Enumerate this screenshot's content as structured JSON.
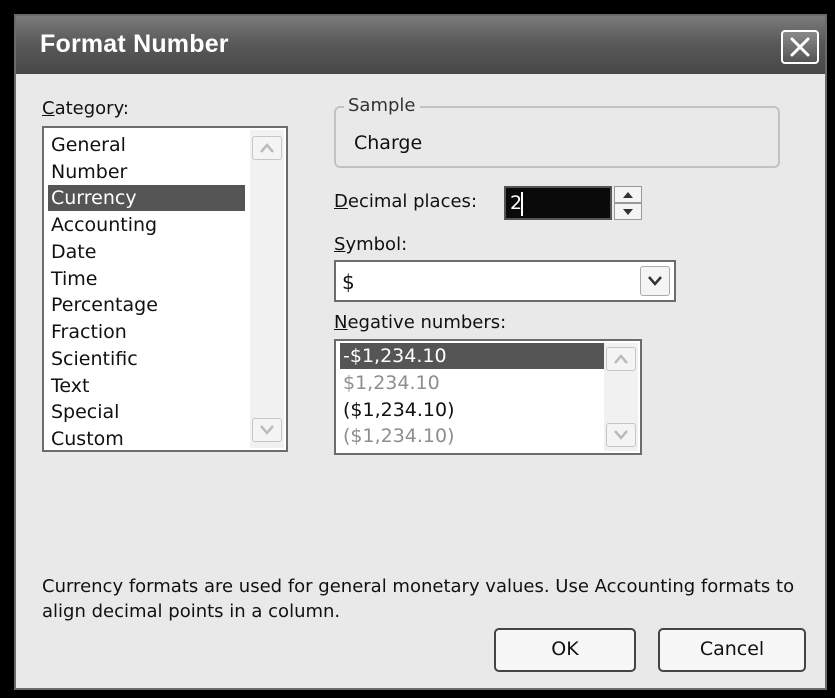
{
  "dialog": {
    "title": "Format Number",
    "close_icon": "close-icon"
  },
  "category": {
    "label": "Category:",
    "items": [
      "General",
      "Number",
      "Currency",
      "Accounting",
      "Date",
      "Time",
      "Percentage",
      "Fraction",
      "Scientific",
      "Text",
      "Special",
      "Custom"
    ],
    "selected": "Currency"
  },
  "sample": {
    "label": "Sample",
    "value": "Charge"
  },
  "decimal_places": {
    "label": "Decimal places:",
    "value": "2"
  },
  "symbol": {
    "label": "Symbol:",
    "value": "$"
  },
  "negative_numbers": {
    "label": "Negative numbers:",
    "items": [
      "-$1,234.10",
      "$1,234.10",
      "($1,234.10)",
      "($1,234.10)"
    ],
    "selected_index": 0,
    "red_indices": [
      1,
      3
    ]
  },
  "help_text": "Currency formats are used for general monetary values.  Use Accounting formats to align decimal points in a column.",
  "buttons": {
    "ok": "OK",
    "cancel": "Cancel"
  },
  "colors": {
    "selection": "#555555",
    "negative_red_rendered_gray": "#8e8e8e"
  }
}
